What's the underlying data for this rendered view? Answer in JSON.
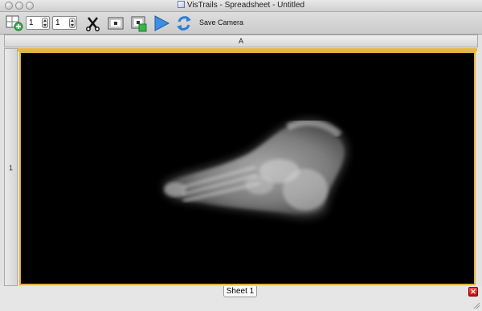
{
  "window": {
    "title": "VisTrails - Spreadsheet - Untitled"
  },
  "toolbar": {
    "rows_value": "1",
    "cols_value": "1",
    "save_camera_label": "Save Camera",
    "icons": [
      "add-sheet-icon",
      "cut-icon",
      "camera-icon",
      "camera-add-icon",
      "play-icon",
      "sync-icon"
    ]
  },
  "spreadsheet": {
    "column_header": "A",
    "row_header": "1",
    "selection_color": "#e0b040"
  },
  "viewer": {
    "subject": "x-ray-foot-volume-render",
    "background_color": "#000000"
  },
  "sheets": {
    "tabs": [
      "Sheet 1"
    ],
    "close_label": "x"
  }
}
